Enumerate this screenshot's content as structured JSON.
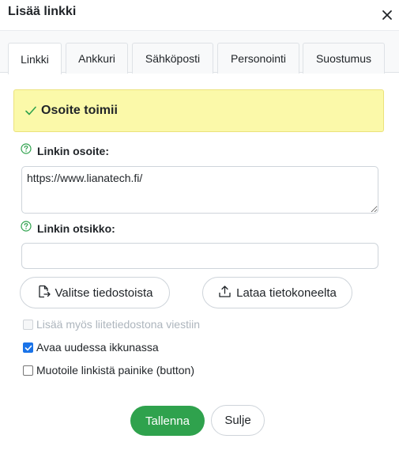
{
  "dialog": {
    "title": "Lisää linkki",
    "close_icon": "close-icon"
  },
  "tabs": [
    {
      "label": "Linkki",
      "active": true
    },
    {
      "label": "Ankkuri",
      "active": false
    },
    {
      "label": "Sähköposti",
      "active": false
    },
    {
      "label": "Personointi",
      "active": false
    },
    {
      "label": "Suostumus",
      "active": false
    }
  ],
  "status": {
    "icon": "check-icon",
    "text": "Osoite toimii",
    "background": "#fbf9a9",
    "icon_color": "#2fa24d"
  },
  "url_field": {
    "help_icon": "help-circle-icon",
    "label": "Linkin osoite:",
    "value": "https://www.lianatech.fi/"
  },
  "title_field": {
    "help_icon": "help-circle-icon",
    "label": "Linkin otsikko:",
    "value": ""
  },
  "file_buttons": {
    "choose_label": "Valitse tiedostoista",
    "choose_icon": "file-import-icon",
    "upload_label": "Lataa tietokoneelta",
    "upload_icon": "upload-icon"
  },
  "options": [
    {
      "label": "Lisää myös liitetiedostona viestiin",
      "checked": false,
      "disabled": true
    },
    {
      "label": "Avaa uudessa ikkunassa",
      "checked": true,
      "disabled": false
    },
    {
      "label": "Muotoile linkistä painike (button)",
      "checked": false,
      "disabled": false
    }
  ],
  "actions": {
    "save_label": "Tallenna",
    "close_label": "Sulje",
    "primary_color": "#2fa24d"
  }
}
